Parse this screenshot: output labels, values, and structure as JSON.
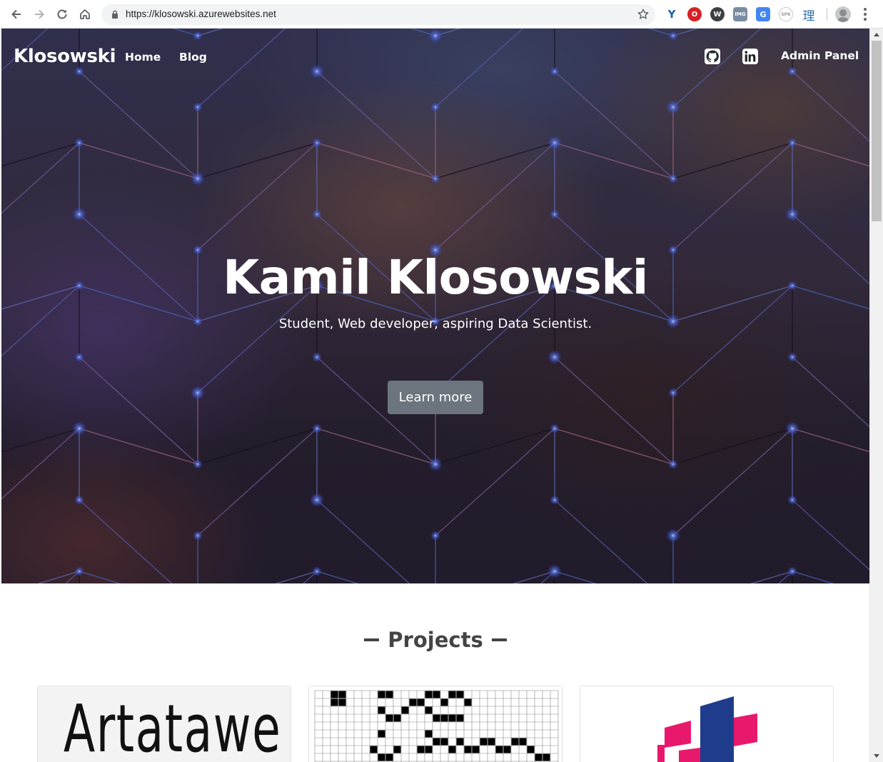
{
  "browser": {
    "url": "https://klosowski.azurewebsites.net",
    "extensions": [
      "Y",
      "O",
      "W",
      "IMG",
      "G",
      "SPK",
      "理"
    ]
  },
  "site": {
    "brand": "Klosowski",
    "nav": {
      "home": "Home",
      "blog": "Blog",
      "admin": "Admin Panel"
    },
    "social": [
      "github-icon",
      "linkedin-icon"
    ]
  },
  "hero": {
    "title": "Kamil Klosowski",
    "subtitle": "Student, Web developer, aspiring Data Scientist.",
    "cta": "Learn more",
    "cta_color": "#6c757d"
  },
  "projects": {
    "heading": "Projects",
    "cards": [
      {
        "image_text": "Artatawe"
      },
      {
        "image": "grid-pattern"
      },
      {
        "image": "logo"
      }
    ]
  },
  "colors": {
    "heading": "#444444",
    "logo_pink": "#e8196d",
    "logo_blue": "#1f3c8c"
  }
}
